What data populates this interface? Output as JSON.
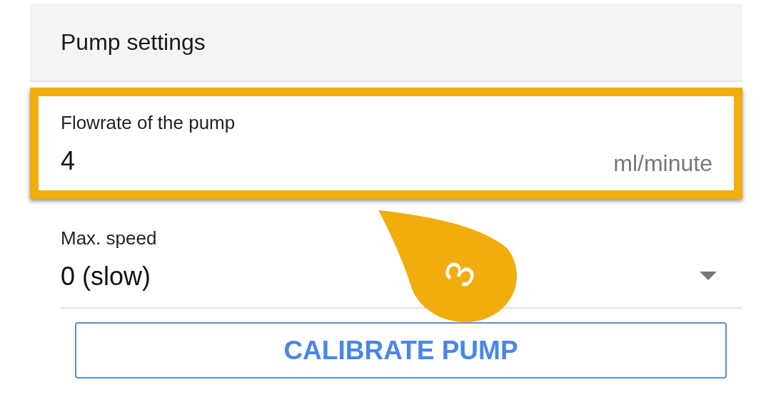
{
  "header": {
    "title": "Pump settings"
  },
  "fields": [
    {
      "kind": "input",
      "label": "Flowrate of the pump",
      "value": "4",
      "unit": "ml/minute",
      "highlighted": true
    },
    {
      "kind": "select",
      "label": "Max. speed",
      "value": "0 (slow)",
      "highlighted": false
    }
  ],
  "button": {
    "label": "CALIBRATE PUMP"
  },
  "callout": {
    "step": "3"
  }
}
